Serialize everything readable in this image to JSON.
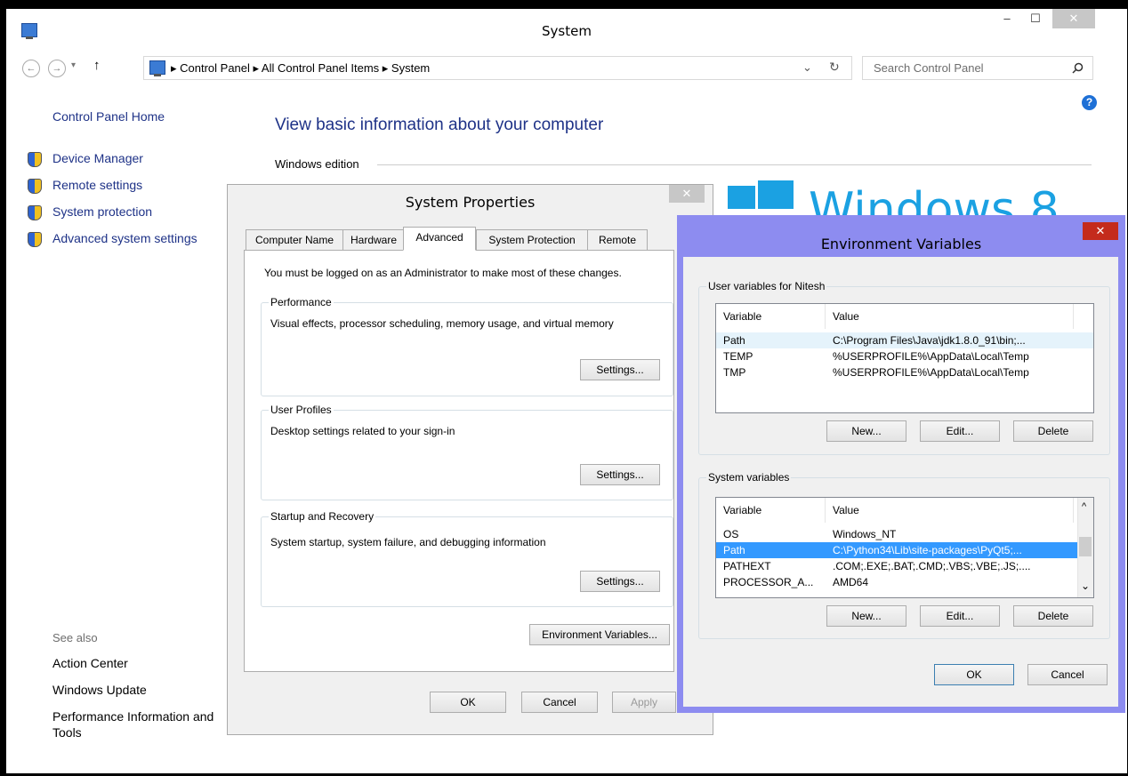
{
  "window": {
    "title": "System",
    "minimize": "–",
    "maximize": "☐",
    "close": "✕"
  },
  "address_bar": {
    "breadcrumbs": "▸ Control Panel ▸ All Control Panel Items ▸ System",
    "dropdown": "⌄",
    "refresh": "↻",
    "search_placeholder": "Search Control Panel",
    "back": "←",
    "forward": "→",
    "recent": "▾",
    "up": "↑"
  },
  "help_icon": "?",
  "left_pane": {
    "home": "Control Panel Home",
    "links": [
      "Device Manager",
      "Remote settings",
      "System protection",
      "Advanced system settings"
    ],
    "see_also": "See also",
    "see_also_links": [
      "Action Center",
      "Windows Update",
      "Performance Information and",
      "Tools"
    ]
  },
  "main": {
    "heading": "View basic information about your computer",
    "windows_edition": "Windows edition",
    "logo_text": "Windows 8"
  },
  "system_properties": {
    "title": "System Properties",
    "close": "✕",
    "tabs": [
      "Computer Name",
      "Hardware",
      "Advanced",
      "System Protection",
      "Remote"
    ],
    "selected_tab": "Advanced",
    "admin_note": "You must be logged on as an Administrator to make most of these changes.",
    "performance": {
      "legend": "Performance",
      "desc": "Visual effects, processor scheduling, memory usage, and virtual memory",
      "button": "Settings..."
    },
    "user_profiles": {
      "legend": "User Profiles",
      "desc": "Desktop settings related to your sign-in",
      "button": "Settings..."
    },
    "startup_recovery": {
      "legend": "Startup and Recovery",
      "desc": "System startup, system failure, and debugging information",
      "button": "Settings..."
    },
    "env_button": "Environment Variables...",
    "ok": "OK",
    "cancel": "Cancel",
    "apply": "Apply"
  },
  "environment_variables": {
    "title": "Environment Variables",
    "close": "✕",
    "user_group": "User variables for Nitesh",
    "system_group": "System variables",
    "col_variable": "Variable",
    "col_value": "Value",
    "user_vars": [
      {
        "name": "Path",
        "value": "C:\\Program Files\\Java\\jdk1.8.0_91\\bin;..."
      },
      {
        "name": "TEMP",
        "value": "%USERPROFILE%\\AppData\\Local\\Temp"
      },
      {
        "name": "TMP",
        "value": "%USERPROFILE%\\AppData\\Local\\Temp"
      }
    ],
    "system_vars": [
      {
        "name": "OS",
        "value": "Windows_NT"
      },
      {
        "name": "Path",
        "value": "C:\\Python34\\Lib\\site-packages\\PyQt5;..."
      },
      {
        "name": "PATHEXT",
        "value": ".COM;.EXE;.BAT;.CMD;.VBS;.VBE;.JS;...."
      },
      {
        "name": "PROCESSOR_A...",
        "value": "AMD64"
      }
    ],
    "selected_system_var": "Path",
    "new": "New...",
    "edit": "Edit...",
    "delete": "Delete",
    "ok": "OK",
    "cancel": "Cancel",
    "scroll_up": "^",
    "scroll_down": "⌄"
  },
  "colors": {
    "link_blue": "#1e3287",
    "selection_blue": "#3399ff",
    "windows_logo": "#1ba1e2",
    "env_border": "#8d8cf0",
    "close_red": "#c42b1c"
  }
}
